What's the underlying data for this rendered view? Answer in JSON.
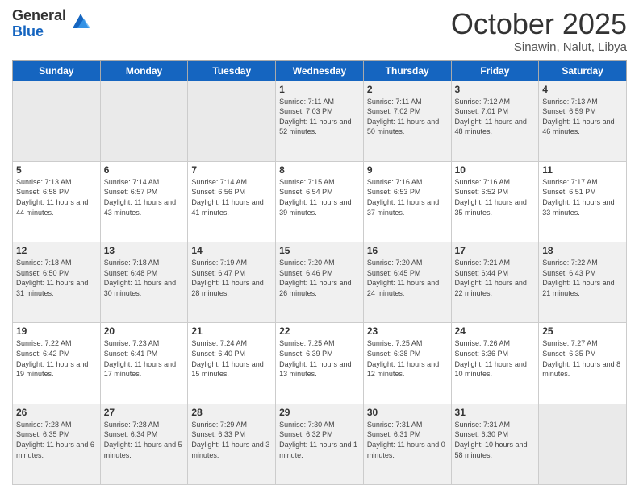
{
  "logo": {
    "general": "General",
    "blue": "Blue"
  },
  "title": "October 2025",
  "location": "Sinawin, Nalut, Libya",
  "days_of_week": [
    "Sunday",
    "Monday",
    "Tuesday",
    "Wednesday",
    "Thursday",
    "Friday",
    "Saturday"
  ],
  "weeks": [
    [
      {
        "day": "",
        "empty": true
      },
      {
        "day": "",
        "empty": true
      },
      {
        "day": "",
        "empty": true
      },
      {
        "day": "1",
        "sunrise": "7:11 AM",
        "sunset": "7:03 PM",
        "daylight": "11 hours and 52 minutes."
      },
      {
        "day": "2",
        "sunrise": "7:11 AM",
        "sunset": "7:02 PM",
        "daylight": "11 hours and 50 minutes."
      },
      {
        "day": "3",
        "sunrise": "7:12 AM",
        "sunset": "7:01 PM",
        "daylight": "11 hours and 48 minutes."
      },
      {
        "day": "4",
        "sunrise": "7:13 AM",
        "sunset": "6:59 PM",
        "daylight": "11 hours and 46 minutes."
      }
    ],
    [
      {
        "day": "5",
        "sunrise": "7:13 AM",
        "sunset": "6:58 PM",
        "daylight": "11 hours and 44 minutes."
      },
      {
        "day": "6",
        "sunrise": "7:14 AM",
        "sunset": "6:57 PM",
        "daylight": "11 hours and 43 minutes."
      },
      {
        "day": "7",
        "sunrise": "7:14 AM",
        "sunset": "6:56 PM",
        "daylight": "11 hours and 41 minutes."
      },
      {
        "day": "8",
        "sunrise": "7:15 AM",
        "sunset": "6:54 PM",
        "daylight": "11 hours and 39 minutes."
      },
      {
        "day": "9",
        "sunrise": "7:16 AM",
        "sunset": "6:53 PM",
        "daylight": "11 hours and 37 minutes."
      },
      {
        "day": "10",
        "sunrise": "7:16 AM",
        "sunset": "6:52 PM",
        "daylight": "11 hours and 35 minutes."
      },
      {
        "day": "11",
        "sunrise": "7:17 AM",
        "sunset": "6:51 PM",
        "daylight": "11 hours and 33 minutes."
      }
    ],
    [
      {
        "day": "12",
        "sunrise": "7:18 AM",
        "sunset": "6:50 PM",
        "daylight": "11 hours and 31 minutes."
      },
      {
        "day": "13",
        "sunrise": "7:18 AM",
        "sunset": "6:48 PM",
        "daylight": "11 hours and 30 minutes."
      },
      {
        "day": "14",
        "sunrise": "7:19 AM",
        "sunset": "6:47 PM",
        "daylight": "11 hours and 28 minutes."
      },
      {
        "day": "15",
        "sunrise": "7:20 AM",
        "sunset": "6:46 PM",
        "daylight": "11 hours and 26 minutes."
      },
      {
        "day": "16",
        "sunrise": "7:20 AM",
        "sunset": "6:45 PM",
        "daylight": "11 hours and 24 minutes."
      },
      {
        "day": "17",
        "sunrise": "7:21 AM",
        "sunset": "6:44 PM",
        "daylight": "11 hours and 22 minutes."
      },
      {
        "day": "18",
        "sunrise": "7:22 AM",
        "sunset": "6:43 PM",
        "daylight": "11 hours and 21 minutes."
      }
    ],
    [
      {
        "day": "19",
        "sunrise": "7:22 AM",
        "sunset": "6:42 PM",
        "daylight": "11 hours and 19 minutes."
      },
      {
        "day": "20",
        "sunrise": "7:23 AM",
        "sunset": "6:41 PM",
        "daylight": "11 hours and 17 minutes."
      },
      {
        "day": "21",
        "sunrise": "7:24 AM",
        "sunset": "6:40 PM",
        "daylight": "11 hours and 15 minutes."
      },
      {
        "day": "22",
        "sunrise": "7:25 AM",
        "sunset": "6:39 PM",
        "daylight": "11 hours and 13 minutes."
      },
      {
        "day": "23",
        "sunrise": "7:25 AM",
        "sunset": "6:38 PM",
        "daylight": "11 hours and 12 minutes."
      },
      {
        "day": "24",
        "sunrise": "7:26 AM",
        "sunset": "6:36 PM",
        "daylight": "11 hours and 10 minutes."
      },
      {
        "day": "25",
        "sunrise": "7:27 AM",
        "sunset": "6:35 PM",
        "daylight": "11 hours and 8 minutes."
      }
    ],
    [
      {
        "day": "26",
        "sunrise": "7:28 AM",
        "sunset": "6:35 PM",
        "daylight": "11 hours and 6 minutes."
      },
      {
        "day": "27",
        "sunrise": "7:28 AM",
        "sunset": "6:34 PM",
        "daylight": "11 hours and 5 minutes."
      },
      {
        "day": "28",
        "sunrise": "7:29 AM",
        "sunset": "6:33 PM",
        "daylight": "11 hours and 3 minutes."
      },
      {
        "day": "29",
        "sunrise": "7:30 AM",
        "sunset": "6:32 PM",
        "daylight": "11 hours and 1 minute."
      },
      {
        "day": "30",
        "sunrise": "7:31 AM",
        "sunset": "6:31 PM",
        "daylight": "11 hours and 0 minutes."
      },
      {
        "day": "31",
        "sunrise": "7:31 AM",
        "sunset": "6:30 PM",
        "daylight": "10 hours and 58 minutes."
      },
      {
        "day": "",
        "empty": true
      }
    ]
  ],
  "labels": {
    "sunrise_prefix": "Sunrise: ",
    "sunset_prefix": "Sunset: ",
    "daylight_prefix": "Daylight: "
  }
}
